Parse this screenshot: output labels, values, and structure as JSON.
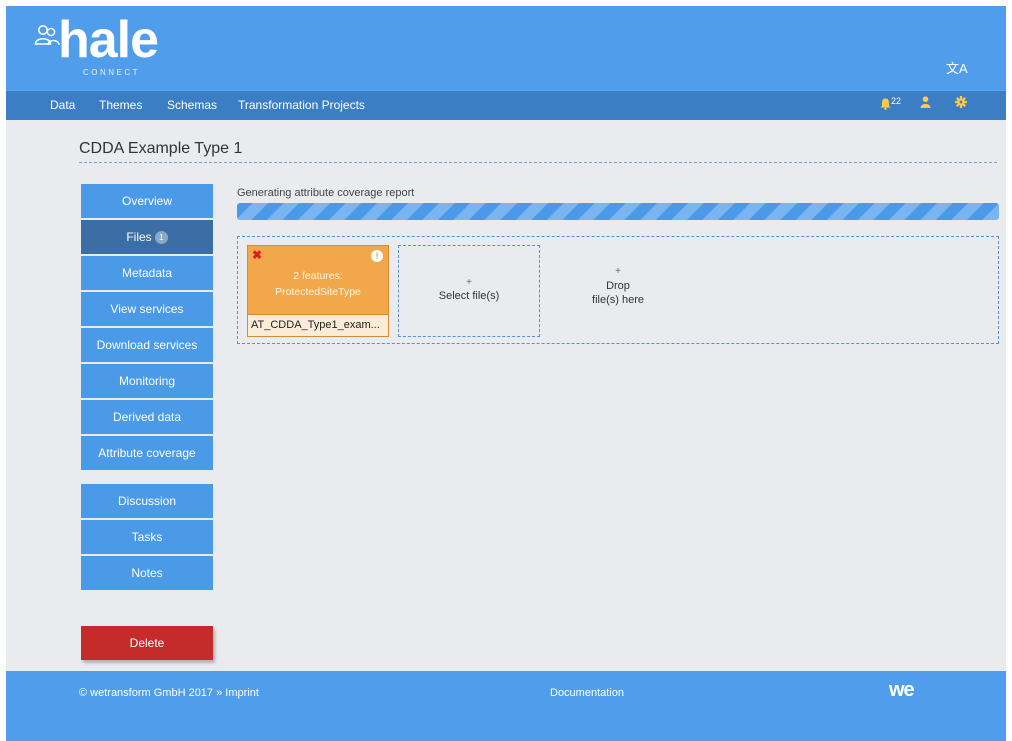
{
  "header": {
    "logo_text": "hale",
    "logo_subtext": "CONNECT",
    "language_icon": "translate-icon"
  },
  "nav": {
    "items": [
      {
        "label": "Data"
      },
      {
        "label": "Themes"
      },
      {
        "label": "Schemas"
      },
      {
        "label": "Transformation Projects"
      }
    ],
    "notifications_count": "22",
    "icons": [
      "bell-icon",
      "user-icon",
      "gear-icon"
    ]
  },
  "page": {
    "title": "CDDA Example Type 1"
  },
  "sidebar": {
    "items": [
      {
        "label": "Overview"
      },
      {
        "label": "Files",
        "badge": "1"
      },
      {
        "label": "Metadata"
      },
      {
        "label": "View services"
      },
      {
        "label": "Download services"
      },
      {
        "label": "Monitoring"
      },
      {
        "label": "Derived data"
      },
      {
        "label": "Attribute coverage"
      },
      {
        "label": "Discussion"
      },
      {
        "label": "Tasks"
      },
      {
        "label": "Notes"
      }
    ],
    "active": "Files",
    "delete_label": "Delete"
  },
  "progress": {
    "label": "Generating attribute coverage report",
    "value": 1.0
  },
  "files": {
    "card": {
      "features_line1": "2 features:",
      "features_line2": "ProtectedSiteType",
      "filename": "AT_CDDA_Type1_exam..."
    },
    "select_plus": "+",
    "select_label": "Select file(s)",
    "drop_plus": "+",
    "drop_line1": "Drop",
    "drop_line2": "file(s) here"
  },
  "footer": {
    "copyright": "© wetransform GmbH 2017 » Imprint",
    "documentation": "Documentation",
    "brand": "we"
  },
  "colors": {
    "header_blue": "#509eeb",
    "nav_blue": "#3b7ec4",
    "sidebar_blue": "#4a9ae8",
    "sidebar_active": "#3a6ea5",
    "file_card_orange": "#f3a74b",
    "delete_red": "#c62b2b"
  }
}
